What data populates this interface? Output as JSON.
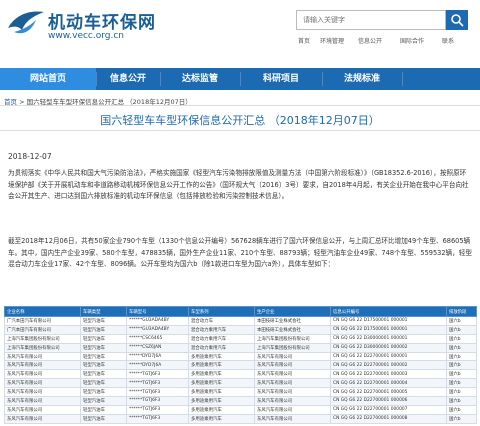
{
  "header": {
    "site_title": "机动车环保网",
    "site_url": "www.vecc.org.cn",
    "search_placeholder": "请输入关键字",
    "top_links": [
      "首页",
      "环境管理",
      "信息公开",
      "国际合作",
      "联系"
    ]
  },
  "nav": {
    "items": [
      "网站首页",
      "信息公开",
      "达标监管",
      "科研项目",
      "法规标准"
    ]
  },
  "breadcrumb": {
    "home": "首页",
    "sep": " > ",
    "current": "国六轻型车车型环保信息公开汇总 （2018年12月07日）"
  },
  "article": {
    "title": "国六轻型车车型环保信息公开汇总 （2018年12月07日）",
    "date": "2018-12-07",
    "para1": "为贯彻落实《中华人民共和国大气污染防治法》，严格实施国家《轻型汽车污染物排放限值及测量方法（中国第六阶段标准）》（GB18352.6-2016），按照原环境保护部《关于开展机动车和非道路移动机械环保信息公开工作的公告》（国环规大气〔2016〕3号）要求，自2018年4月起，有关企业开始在我中心平台向社会公开其生产、进口达到国六排放标准的机动车环保信息（包括排放检验和污染控制技术信息）。",
    "para2": "截至2018年12月06日，共有50家企业790个车型（1330个信息公开编号）567628辆车进行了国六环保信息公开，与上周汇总环比增加49个车型、68605辆车。其中，国内生产企业39家、580个车型，478835辆，国外生产企业11家、210个车型、88793辆；轻型汽油车企业49家、748个车型、559532辆，轻型混合动力车企业17家、42个车型、8096辆。公开车型均为国六b（除1款进口车型为国六a外），具体车型如下："
  },
  "table": {
    "headers": [
      "企业名称",
      "车辆类型",
      "车辆型号",
      "车型系列",
      "生产企业",
      "信息公开编号",
      "排放阶段"
    ],
    "rows": [
      [
        "广汽本田汽车有限公司",
        "轻型汽油车",
        "******GU3ADA4BY",
        "混合动力车",
        "本田技研工业株式会社",
        "CN GQ G6 22 D17500001 000001",
        "国六b"
      ],
      [
        "广汽本田汽车有限公司",
        "轻型汽油车",
        "******GU3ADA4BY",
        "混合动力乘用汽车",
        "本田技研工业株式会社",
        "CN GQ G6 22 D17500001 000001",
        "国六b"
      ],
      [
        "上海汽车集团股份有限公司",
        "轻型汽油车",
        "******CSC6465",
        "混合动力乘用汽车",
        "上海汽车集团股份有限公司",
        "CN GQ G6 22 D30000001 000001",
        "国六b"
      ],
      [
        "上海汽车集团股份有限公司",
        "轻型汽油车",
        "******CSZ6JAN",
        "混合动力乘用汽车",
        "上海汽车集团股份有限公司",
        "CN GQ G6 22 D30000001 000002",
        "国六b"
      ],
      [
        "东风汽车有限公司",
        "轻型汽油车",
        "******DYD7J6A",
        "多用途乘用汽车",
        "东风汽车有限公司",
        "CN GQ G6 22 D22700001 000001",
        "国六b"
      ],
      [
        "东风汽车有限公司",
        "轻型汽油车",
        "******DYD7J6A",
        "多用途乘用汽车",
        "东风汽车有限公司",
        "CN GQ G6 22 D22700001 000002",
        "国六b"
      ],
      [
        "东风汽车有限公司",
        "轻型汽油车",
        "******TGTJ6F3",
        "多用途乘用汽车",
        "东风汽车有限公司",
        "CN GQ G6 22 D22700001 000003",
        "国六b"
      ],
      [
        "东风汽车有限公司",
        "轻型汽油车",
        "******TGTJ6F3",
        "多用途乘用汽车",
        "东风汽车有限公司",
        "CN GQ G6 22 D22700001 000004",
        "国六b"
      ],
      [
        "东风汽车有限公司",
        "轻型汽油车",
        "******TGTJ6F3",
        "多用途乘用汽车",
        "东风汽车有限公司",
        "CN GQ G6 22 D22700001 000005",
        "国六b"
      ],
      [
        "东风汽车有限公司",
        "轻型汽油车",
        "******TGTJ6F3",
        "多用途乘用汽车",
        "东风汽车有限公司",
        "CN GQ G6 22 D22700001 000006",
        "国六b"
      ],
      [
        "东风汽车有限公司",
        "轻型汽油车",
        "******TGTJ6F3",
        "多用途乘用汽车",
        "东风汽车有限公司",
        "CN GQ G6 22 D22700001 000007",
        "国六b"
      ],
      [
        "东风汽车有限公司",
        "轻型汽油车",
        "******TGTJ6F3",
        "多用途乘用汽车",
        "东风汽车有限公司",
        "CN GQ G6 22 D22700001 000008",
        "国六b"
      ]
    ]
  }
}
